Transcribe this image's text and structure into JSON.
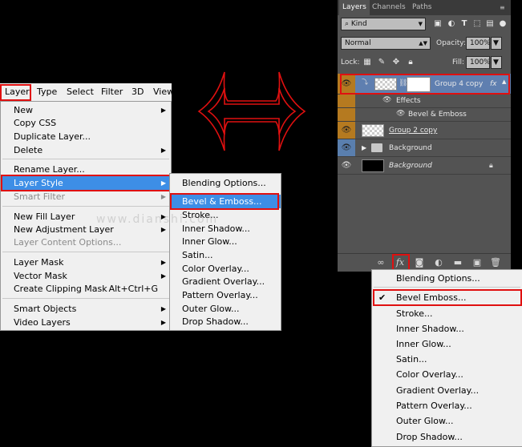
{
  "menubar": {
    "items": [
      "Layer",
      "Type",
      "Select",
      "Filter",
      "3D",
      "View"
    ]
  },
  "layer_menu": {
    "items": [
      {
        "label": "New",
        "arrow": "▶"
      },
      {
        "label": "Copy CSS"
      },
      {
        "label": "Duplicate Layer..."
      },
      {
        "label": "Delete",
        "arrow": "▶"
      },
      {
        "label": "Rename Layer..."
      },
      {
        "label": "Layer Style",
        "arrow": "▶"
      },
      {
        "label": "Smart Filter",
        "arrow": "▶"
      },
      {
        "label": "New Fill Layer",
        "arrow": "▶"
      },
      {
        "label": "New Adjustment Layer",
        "arrow": "▶"
      },
      {
        "label": "Layer Content Options..."
      },
      {
        "label": "Layer Mask",
        "arrow": "▶"
      },
      {
        "label": "Vector Mask",
        "arrow": "▶"
      },
      {
        "label": "Create Clipping Mask",
        "shortcut": "Alt+Ctrl+G"
      },
      {
        "label": "Smart Objects",
        "arrow": "▶"
      },
      {
        "label": "Video Layers",
        "arrow": "▶"
      }
    ]
  },
  "style_menu": {
    "items": [
      "Blending Options...",
      "Bevel & Emboss...",
      "Stroke...",
      "Inner Shadow...",
      "Inner Glow...",
      "Satin...",
      "Color Overlay...",
      "Gradient Overlay...",
      "Pattern Overlay...",
      "Outer Glow...",
      "Drop Shadow..."
    ]
  },
  "panel": {
    "tabs": [
      "Layers",
      "Channels",
      "Paths"
    ],
    "kind_label": "Kind",
    "blend_mode": "Normal",
    "opacity_label": "Opacity:",
    "opacity_value": "100%",
    "lock_label": "Lock:",
    "fill_label": "Fill:",
    "fill_value": "100%",
    "layers": {
      "group4": "Group 4 copy",
      "effects": "Effects",
      "bevel": "Bevel & Emboss",
      "group2": "Group 2 copy",
      "background_group": "Background",
      "background": "Background"
    },
    "fx_label": "fx"
  },
  "fx_menu": {
    "items": [
      "Blending Options...",
      "Bevel  Emboss...",
      "Stroke...",
      "Inner Shadow...",
      "Inner Glow...",
      "Satin...",
      "Color Overlay...",
      "Gradient Overlay...",
      "Pattern Overlay...",
      "Outer Glow...",
      "Drop Shadow..."
    ],
    "check": "✔"
  },
  "watermark": "www.dianshi.com",
  "colors": {
    "highlight": "#3d8ee6",
    "annotation_red": "#e01010",
    "panel_bg": "#535353",
    "eye_orange": "#b57a20"
  }
}
